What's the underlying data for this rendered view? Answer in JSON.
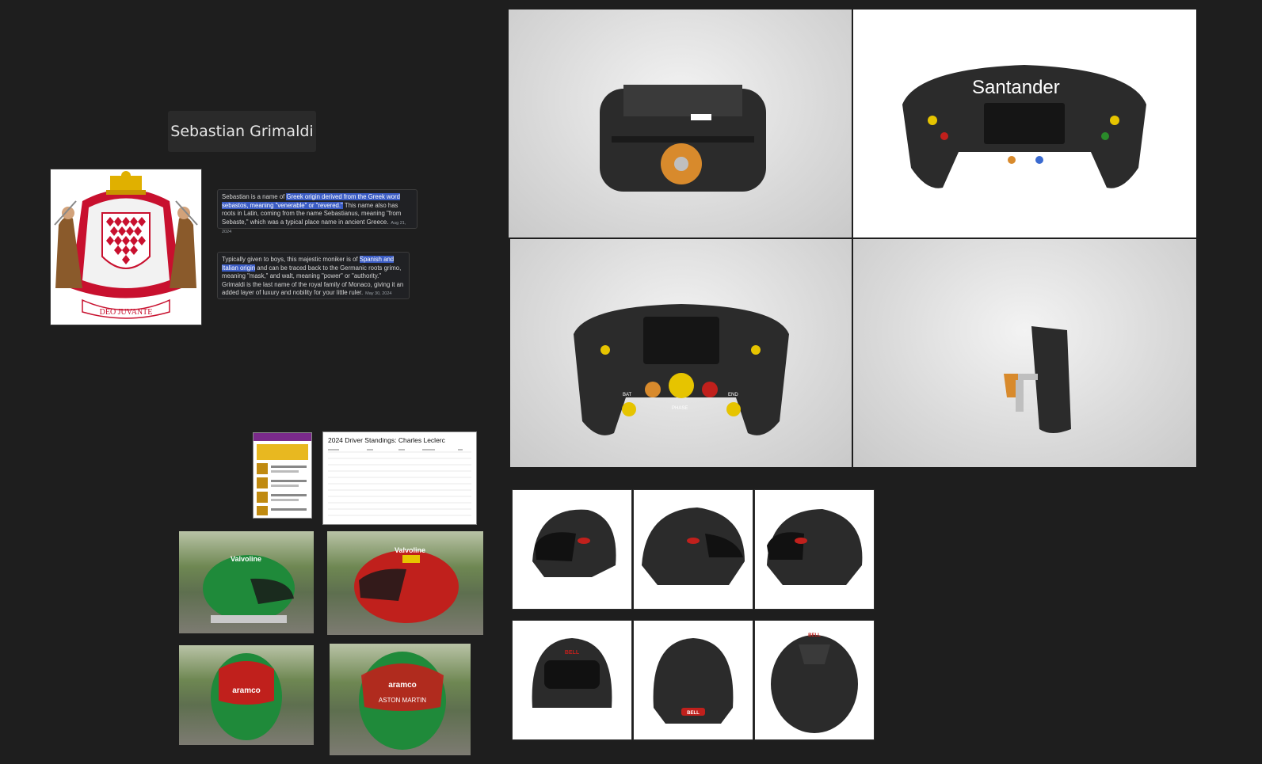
{
  "title_note": {
    "text": "Sebastian Grimaldi"
  },
  "coat_of_arms": {
    "motto": "DEO JUVANTE"
  },
  "snippet_1": {
    "pre": "Sebastian is a name of ",
    "highlight": "Greek origin derived from the Greek word sebastos, meaning \"venerable\" or \"revered.\"",
    "post": " This name also has roots in Latin, coming from the name Sebastianus, meaning \"from Sebaste,\" which was a typical place name in ancient Greece.",
    "date": "Aug 21, 2024"
  },
  "snippet_2": {
    "pre": "Typically given to boys, this majestic moniker is of ",
    "highlight": "Spanish and Italian origin",
    "post": " and can be traced back to the Germanic roots grimo, meaning \"mask,\" and walt, meaning \"power\" or \"authority.\" Grimaldi is the last name of the royal family of Monaco, giving it an added layer of luxury and nobility for your little ruler.",
    "date": "May 30, 2024"
  },
  "standings_doc": {
    "heading": "2024 Driver Standings: Charles Leclerc"
  },
  "wheel_2": {
    "brand": "Santander"
  },
  "wheel_3": {
    "labels": [
      "BAT",
      "PHASE",
      "END"
    ]
  },
  "helmets_photo": {
    "brand_green": "Valvoline",
    "brand_red": "Valvoline",
    "brand_front": "aramco",
    "brand_aston": "ASTON MARTIN"
  },
  "bell_label": "BELL",
  "colors": {
    "canvas": "#1e1e1e",
    "highlight": "#3b5cc4",
    "ferrari_red": "#d40000",
    "helmet_green": "#1f8a3a",
    "carbon": "#2b2b2b"
  }
}
